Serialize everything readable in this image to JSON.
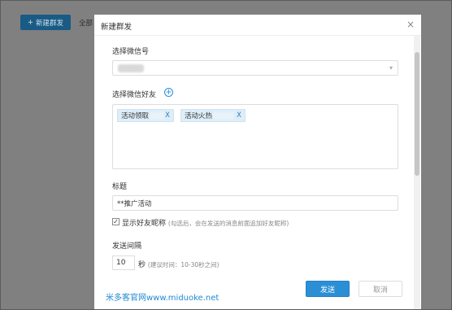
{
  "background": {
    "new_button_icon": "+",
    "new_button_label": "新建群发",
    "tab_label": "全部"
  },
  "dialog": {
    "title": "新建群发",
    "close_icon": "×",
    "wechat_label": "选择微信号",
    "friends_label": "选择微信好友",
    "add_icon": "+",
    "friends": [
      {
        "label": "活动领取",
        "remove": "X"
      },
      {
        "label": "活动火热",
        "remove": "X"
      }
    ],
    "title_label": "标题",
    "title_value": "**推广活动",
    "show_nickname_checked": "✓",
    "show_nickname_label": "显示好友昵称",
    "show_nickname_hint": "(勾选后，会在发送的消息前面追加好友昵称)",
    "interval_label": "发送间隔",
    "interval_value": "10",
    "interval_unit": "秒",
    "interval_hint": "(建议时间：10-30秒之间)",
    "send_button": "发送",
    "cancel_button": "取消"
  },
  "watermark": "米多客官网www.miduoke.net"
}
